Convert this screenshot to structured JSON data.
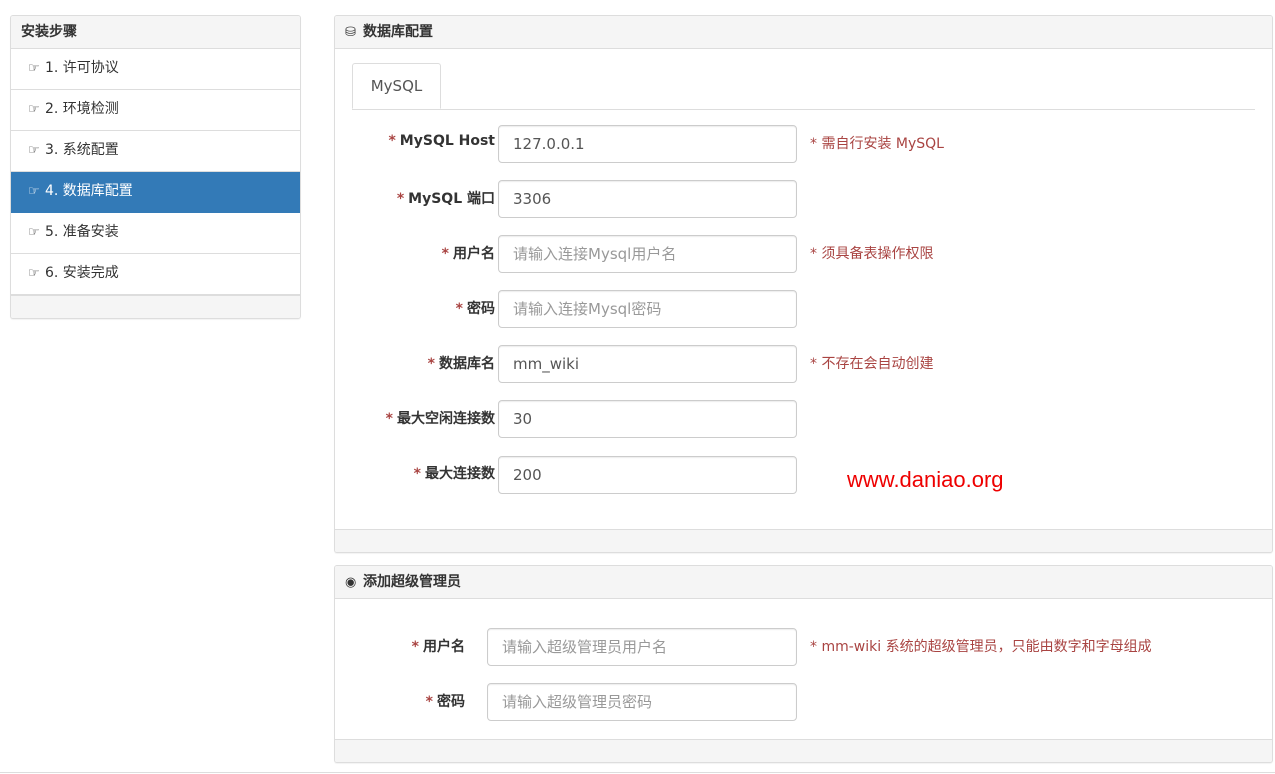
{
  "steps": {
    "title": "安装步骤",
    "items": [
      {
        "label": "1. 许可协议"
      },
      {
        "label": "2. 环境检测"
      },
      {
        "label": "3. 系统配置"
      },
      {
        "label": "4. 数据库配置"
      },
      {
        "label": "5. 准备安装"
      },
      {
        "label": "6. 安装完成"
      }
    ]
  },
  "db": {
    "title": "数据库配置",
    "tab": "MySQL",
    "fields": [
      {
        "label": "MySQL Host",
        "value": "127.0.0.1",
        "placeholder": "",
        "hint": "* 需自行安装 MySQL"
      },
      {
        "label": "MySQL 端口",
        "value": "3306",
        "placeholder": "",
        "hint": ""
      },
      {
        "label": "用户名",
        "value": "",
        "placeholder": "请输入连接Mysql用户名",
        "hint": "* 须具备表操作权限"
      },
      {
        "label": "密码",
        "value": "",
        "placeholder": "请输入连接Mysql密码",
        "hint": ""
      },
      {
        "label": "数据库名",
        "value": "mm_wiki",
        "placeholder": "",
        "hint": "* 不存在会自动创建"
      },
      {
        "label": "最大空闲连接数",
        "value": "30",
        "placeholder": "",
        "hint": ""
      },
      {
        "label": "最大连接数",
        "value": "200",
        "placeholder": "",
        "hint": ""
      }
    ],
    "watermark": "www.daniao.org"
  },
  "admin": {
    "title": "添加超级管理员",
    "fields": [
      {
        "label": "用户名",
        "value": "",
        "placeholder": "请输入超级管理员用户名",
        "hint": "* mm-wiki 系统的超级管理员，只能由数字和字母组成"
      },
      {
        "label": "密码",
        "value": "",
        "placeholder": "请输入超级管理员密码",
        "hint": ""
      }
    ]
  },
  "required_mark": "*",
  "icons": {
    "step": "hand-point-right-icon",
    "db": "database-icon",
    "admin": "user-circle-icon"
  },
  "colors": {
    "active": "#337ab7",
    "hint": "#a94442",
    "watermark": "#e00000"
  }
}
